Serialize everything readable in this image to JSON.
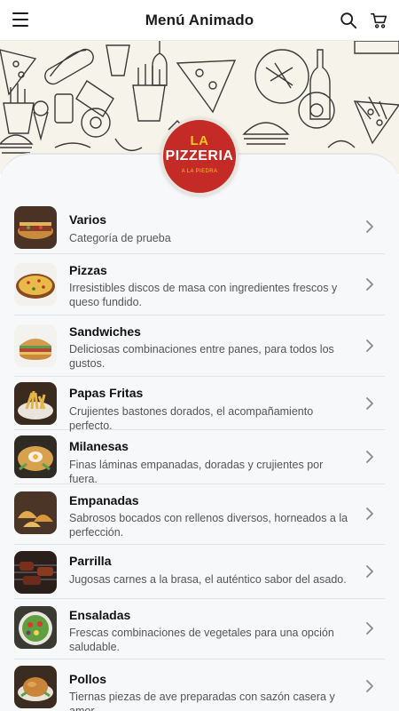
{
  "header": {
    "title": "Menú Animado",
    "menu_icon": "hamburger-menu-icon",
    "search_icon": "search-icon",
    "cart_icon": "cart-icon"
  },
  "logo": {
    "line1": "LA",
    "line2": "PIZZERIA",
    "line3": "A LA PIEDRA"
  },
  "categories": [
    {
      "name": "Varios",
      "description": "Categoría de prueba"
    },
    {
      "name": "Pizzas",
      "description": "Irresistibles discos de masa con ingredientes frescos y queso fundido."
    },
    {
      "name": "Sandwiches",
      "description": "Deliciosas combinaciones entre panes, para todos los gustos."
    },
    {
      "name": "Papas Fritas",
      "description": "Crujientes bastones dorados, el acompañamiento perfecto."
    },
    {
      "name": "Milanesas",
      "description": "Finas láminas empanadas, doradas y crujientes por fuera."
    },
    {
      "name": "Empanadas",
      "description": "Sabrosos bocados con rellenos diversos, horneados a la perfección."
    },
    {
      "name": "Parrilla",
      "description": "Jugosas carnes a la brasa, el auténtico sabor del asado."
    },
    {
      "name": "Ensaladas",
      "description": "Frescas combinaciones de vegetales para una opción saludable."
    },
    {
      "name": "Pollos",
      "description": "Tiernas piezas de ave preparadas con sazón casera y amor."
    }
  ],
  "colors": {
    "logo_red": "#c52b26",
    "logo_yellow": "#f5c518",
    "card_bg": "#f7f8fa"
  }
}
